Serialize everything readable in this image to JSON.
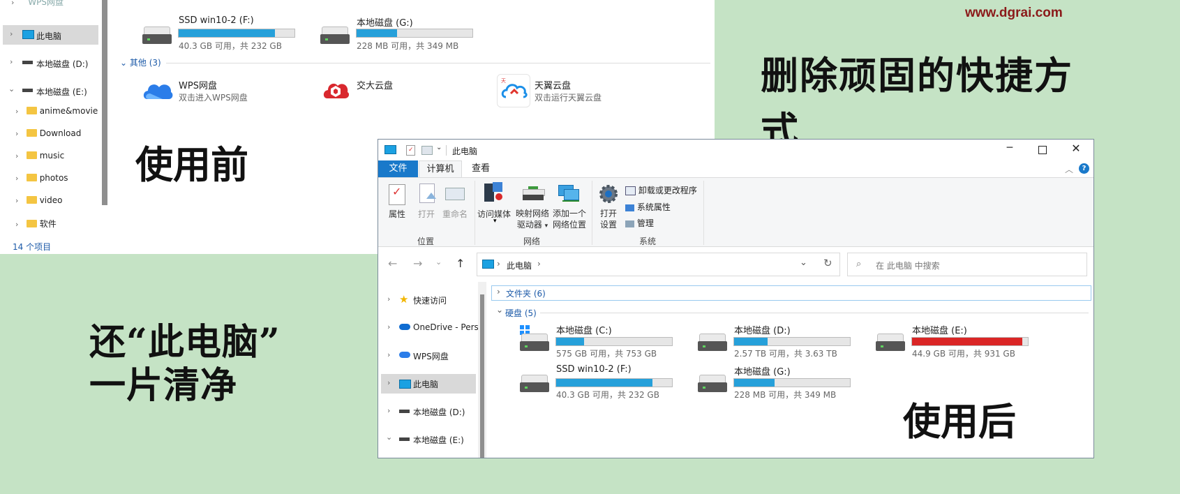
{
  "watermark": "www.dgrai.com",
  "captions": {
    "title": "删除顽固的快捷方式",
    "before": "使用前",
    "after": "使用后",
    "restore_line1": "还“此电脑”",
    "restore_line2": "一片清净"
  },
  "before_window": {
    "nav": {
      "wps_cut": "WPS网盘",
      "this_pc": "此电脑",
      "disk_d": "本地磁盘 (D:)",
      "disk_e": "本地磁盘 (E:)",
      "folders": [
        "anime&movie",
        "Download",
        "music",
        "photos",
        "video",
        "软件"
      ]
    },
    "status": "14 个项目",
    "drives": [
      {
        "name": "SSD win10-2 (F:)",
        "info": "40.3 GB 可用，共 232 GB",
        "used_fraction": 0.83
      },
      {
        "name": "本地磁盘 (G:)",
        "info": "228 MB 可用，共 349 MB",
        "used_fraction": 0.35
      }
    ],
    "other_header": "其他 (3)",
    "others": [
      {
        "name": "WPS网盘",
        "sub": "双击进入WPS网盘",
        "icon": "wps-cloud-icon"
      },
      {
        "name": "交大云盘",
        "sub": "",
        "icon": "jiaoda-cloud-icon"
      },
      {
        "name": "天翼云盘",
        "sub": "双击运行天翼云盘",
        "icon": "tianyi-cloud-icon"
      }
    ]
  },
  "after_window": {
    "title": "此电脑",
    "tabs": {
      "file": "文件",
      "computer": "计算机",
      "view": "查看"
    },
    "ribbon": {
      "properties": "属性",
      "open": "打开",
      "rename": "重命名",
      "access_media": "访问媒体",
      "map_drive_1": "映射网络",
      "map_drive_2": "驱动器",
      "add_location_1": "添加一个",
      "add_location_2": "网络位置",
      "open_settings_1": "打开",
      "open_settings_2": "设置",
      "uninstall": "卸载或更改程序",
      "system_props": "系统属性",
      "manage": "管理",
      "group_location": "位置",
      "group_network": "网络",
      "group_system": "系统"
    },
    "address": {
      "path": "此电脑",
      "search_placeholder": "在 此电脑 中搜索"
    },
    "nav": {
      "quick_access": "快速访问",
      "onedrive": "OneDrive - Pers",
      "wps": "WPS网盘",
      "this_pc": "此电脑",
      "disk_d": "本地磁盘 (D:)",
      "disk_e": "本地磁盘 (E:)"
    },
    "folders_header": "文件夹 (6)",
    "disks_header": "硬盘 (5)",
    "drives": [
      {
        "name": "本地磁盘 (C:)",
        "info": "575 GB 可用，共 753 GB",
        "used_fraction": 0.24
      },
      {
        "name": "本地磁盘 (D:)",
        "info": "2.57 TB 可用，共 3.63 TB",
        "used_fraction": 0.29
      },
      {
        "name": "本地磁盘 (E:)",
        "info": "44.9 GB 可用，共 931 GB",
        "used_fraction": 0.95
      },
      {
        "name": "SSD win10-2 (F:)",
        "info": "40.3 GB 可用，共 232 GB",
        "used_fraction": 0.83
      },
      {
        "name": "本地磁盘 (G:)",
        "info": "228 MB 可用，共 349 MB",
        "used_fraction": 0.35
      }
    ]
  }
}
